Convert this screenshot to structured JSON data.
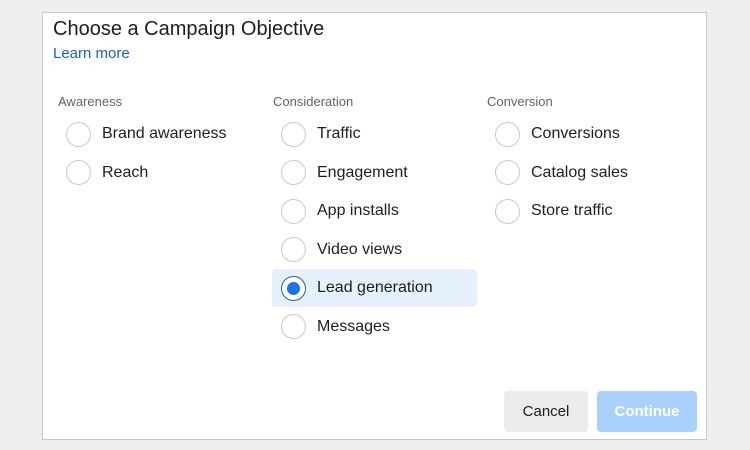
{
  "dialog": {
    "title": "Choose a Campaign Objective",
    "learn_more": "Learn more"
  },
  "groups": [
    {
      "label": "Awareness",
      "options": [
        {
          "label": "Brand awareness",
          "selected": false
        },
        {
          "label": "Reach",
          "selected": false
        }
      ]
    },
    {
      "label": "Consideration",
      "options": [
        {
          "label": "Traffic",
          "selected": false
        },
        {
          "label": "Engagement",
          "selected": false
        },
        {
          "label": "App installs",
          "selected": false
        },
        {
          "label": "Video views",
          "selected": false
        },
        {
          "label": "Lead generation",
          "selected": true
        },
        {
          "label": "Messages",
          "selected": false
        }
      ]
    },
    {
      "label": "Conversion",
      "options": [
        {
          "label": "Conversions",
          "selected": false
        },
        {
          "label": "Catalog sales",
          "selected": false
        },
        {
          "label": "Store traffic",
          "selected": false
        }
      ]
    }
  ],
  "buttons": {
    "cancel": "Cancel",
    "continue": "Continue",
    "continue_disabled": true
  },
  "colors": {
    "link": "#1a5fd0",
    "selected_radio": "#1a73e8",
    "selected_row_bg": "#e6f1fd",
    "continue_disabled_bg": "#a9d1fb",
    "cancel_bg": "#ececec"
  }
}
